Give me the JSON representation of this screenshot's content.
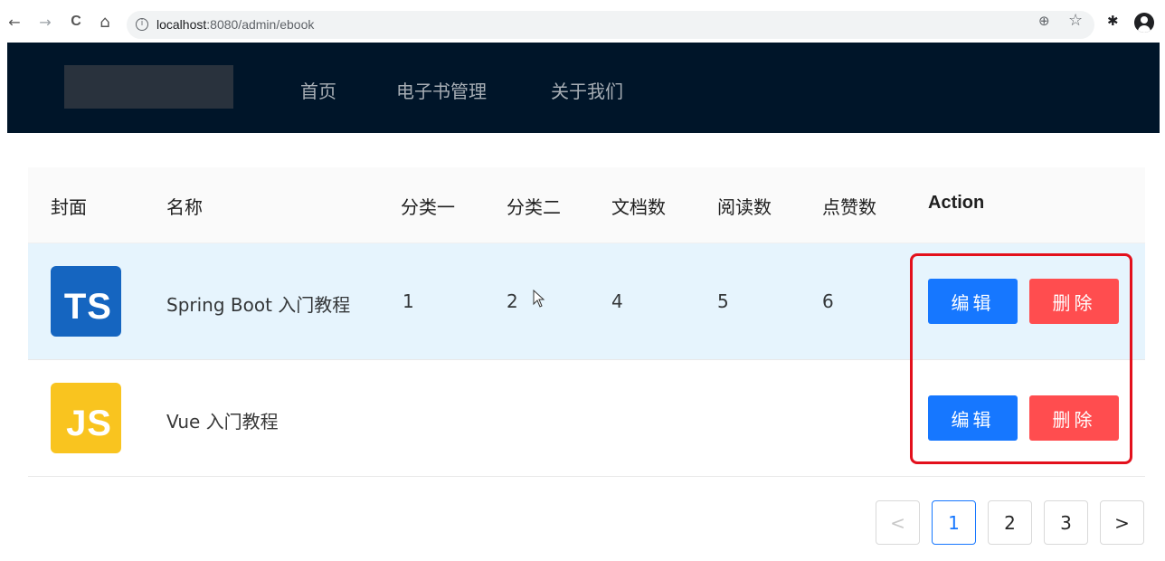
{
  "browser": {
    "back_glyph": "←",
    "forward_glyph": "→",
    "reload_glyph": "C",
    "home_glyph": "⌂",
    "info_glyph": "i",
    "url_host": "localhost",
    "url_path": ":8080/admin/ebook",
    "zoom_glyph": "⊕",
    "star_glyph": "☆",
    "extensions_glyph": "✱"
  },
  "header": {
    "menu": [
      {
        "label": "首页"
      },
      {
        "label": "电子书管理"
      },
      {
        "label": "关于我们"
      }
    ]
  },
  "table": {
    "columns": [
      "封面",
      "名称",
      "分类一",
      "分类二",
      "文档数",
      "阅读数",
      "点赞数",
      "Action"
    ],
    "rows": [
      {
        "cover_text": "TS",
        "name": "Spring Boot 入门教程",
        "category1": "1",
        "category2": "2",
        "docs": "4",
        "views": "5",
        "likes": "6",
        "edit_label": "编辑",
        "delete_label": "删除"
      },
      {
        "cover_text": "JS",
        "name": "Vue 入门教程",
        "category1": "",
        "category2": "",
        "docs": "",
        "views": "",
        "likes": "",
        "edit_label": "编辑",
        "delete_label": "删除"
      }
    ]
  },
  "pagination": {
    "prev_glyph": "<",
    "pages": [
      "1",
      "2",
      "3"
    ],
    "next_glyph": ">",
    "current": "1"
  },
  "colors": {
    "header_bg": "#001529",
    "primary": "#1677ff",
    "danger": "#ff4d4f",
    "highlight_frame": "#e3101c",
    "hover_row": "#e6f4fd"
  }
}
